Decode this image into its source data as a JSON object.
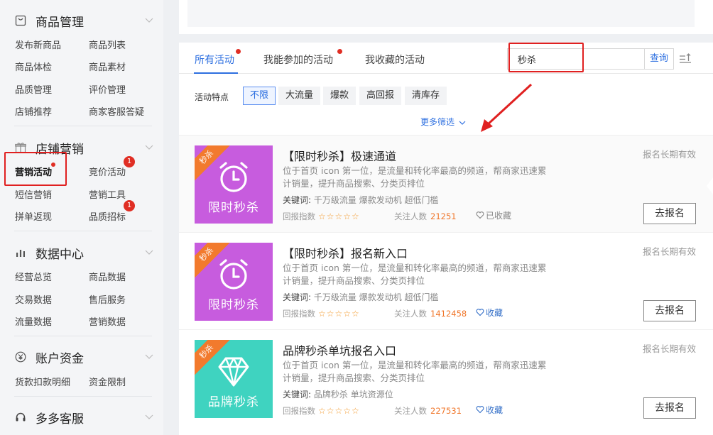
{
  "sidebar": {
    "sections": [
      {
        "title": "商品管理",
        "icon": "product-box-icon",
        "links": [
          "发布新商品",
          "商品列表",
          "商品体检",
          "商品素材",
          "品质管理",
          "评价管理",
          "店铺推荐",
          "商家客服答疑"
        ]
      },
      {
        "title": "店铺营销",
        "icon": "gift-icon",
        "links": [
          "营销活动",
          "竞价活动",
          "短信营销",
          "营销工具",
          "拼单返现",
          "品质招标"
        ],
        "badges": [
          "1",
          "1"
        ]
      },
      {
        "title": "数据中心",
        "icon": "bar-chart-icon",
        "links": [
          "经营总览",
          "商品数据",
          "交易数据",
          "售后服务",
          "流量数据",
          "营销数据"
        ]
      },
      {
        "title": "账户资金",
        "icon": "yen-coin-icon",
        "links": [
          "货款扣款明细",
          "资金限制"
        ]
      },
      {
        "title": "多多客服",
        "icon": "headset-icon",
        "links": []
      }
    ]
  },
  "tabs": [
    {
      "label": "所有活动",
      "active": true
    },
    {
      "label": "我能参加的活动",
      "active": false
    },
    {
      "label": "我收藏的活动",
      "active": false
    }
  ],
  "search": {
    "value": "秒杀",
    "button": "查询"
  },
  "filters": {
    "label": "活动特点",
    "options": [
      "不限",
      "大流量",
      "爆款",
      "高回报",
      "清库存"
    ],
    "selected": "不限",
    "more": "更多筛选"
  },
  "activities": [
    {
      "title": "【限时秒杀】极速通道",
      "ribbon": "秒杀",
      "thumb_text": "限时秒杀",
      "thumb_color": "#c75cde",
      "thumb_icon": "alarm-clock-icon",
      "description": "位于首页 icon 第一位，是流量和转化率最高的频道，帮商家迅速累计销量，提升商品搜索、分类页排位",
      "keywords_label": "关键词:",
      "keywords": "千万级流量 爆款发动机 超低门槛",
      "rating_label": "回报指数",
      "stars": "☆☆☆☆☆",
      "followers_label": "关注人数",
      "followers": "21251",
      "favorite": "已收藏",
      "favorited": true,
      "validity": "报名长期有效",
      "signup": "去报名"
    },
    {
      "title": "【限时秒杀】报名新入口",
      "ribbon": "秒杀",
      "thumb_text": "限时秒杀",
      "thumb_color": "#c75cde",
      "thumb_icon": "alarm-clock-icon",
      "description": "位于首页 icon 第一位，是流量和转化率最高的频道，帮商家迅速累计销量，提升商品搜索、分类页排位",
      "keywords_label": "关键词:",
      "keywords": "千万级流量 爆款发动机 超低门槛",
      "rating_label": "回报指数",
      "stars": "☆☆☆☆☆",
      "followers_label": "关注人数",
      "followers": "1412458",
      "favorite": "收藏",
      "favorited": false,
      "validity": "报名长期有效",
      "signup": "去报名"
    },
    {
      "title": "品牌秒杀单坑报名入口",
      "ribbon": "秒杀",
      "thumb_text": "品牌秒杀",
      "thumb_color": "#3fd3c0",
      "thumb_icon": "diamond-icon",
      "description": "位于首页 icon 第一位，是流量和转化率最高的频道，帮商家迅速累计销量，提升商品搜索、分类页排位",
      "keywords_label": "关键词:",
      "keywords": "品牌秒杀 单坑资源位",
      "rating_label": "回报指数",
      "stars": "☆☆☆☆☆",
      "followers_label": "关注人数",
      "followers": "227531",
      "favorite": "收藏",
      "favorited": false,
      "validity": "报名长期有效",
      "signup": "去报名"
    }
  ],
  "colors": {
    "accent": "#2d6fe0",
    "badge": "#e02e24",
    "annotation": "#e02020",
    "ribbon": "#f27a2d"
  }
}
